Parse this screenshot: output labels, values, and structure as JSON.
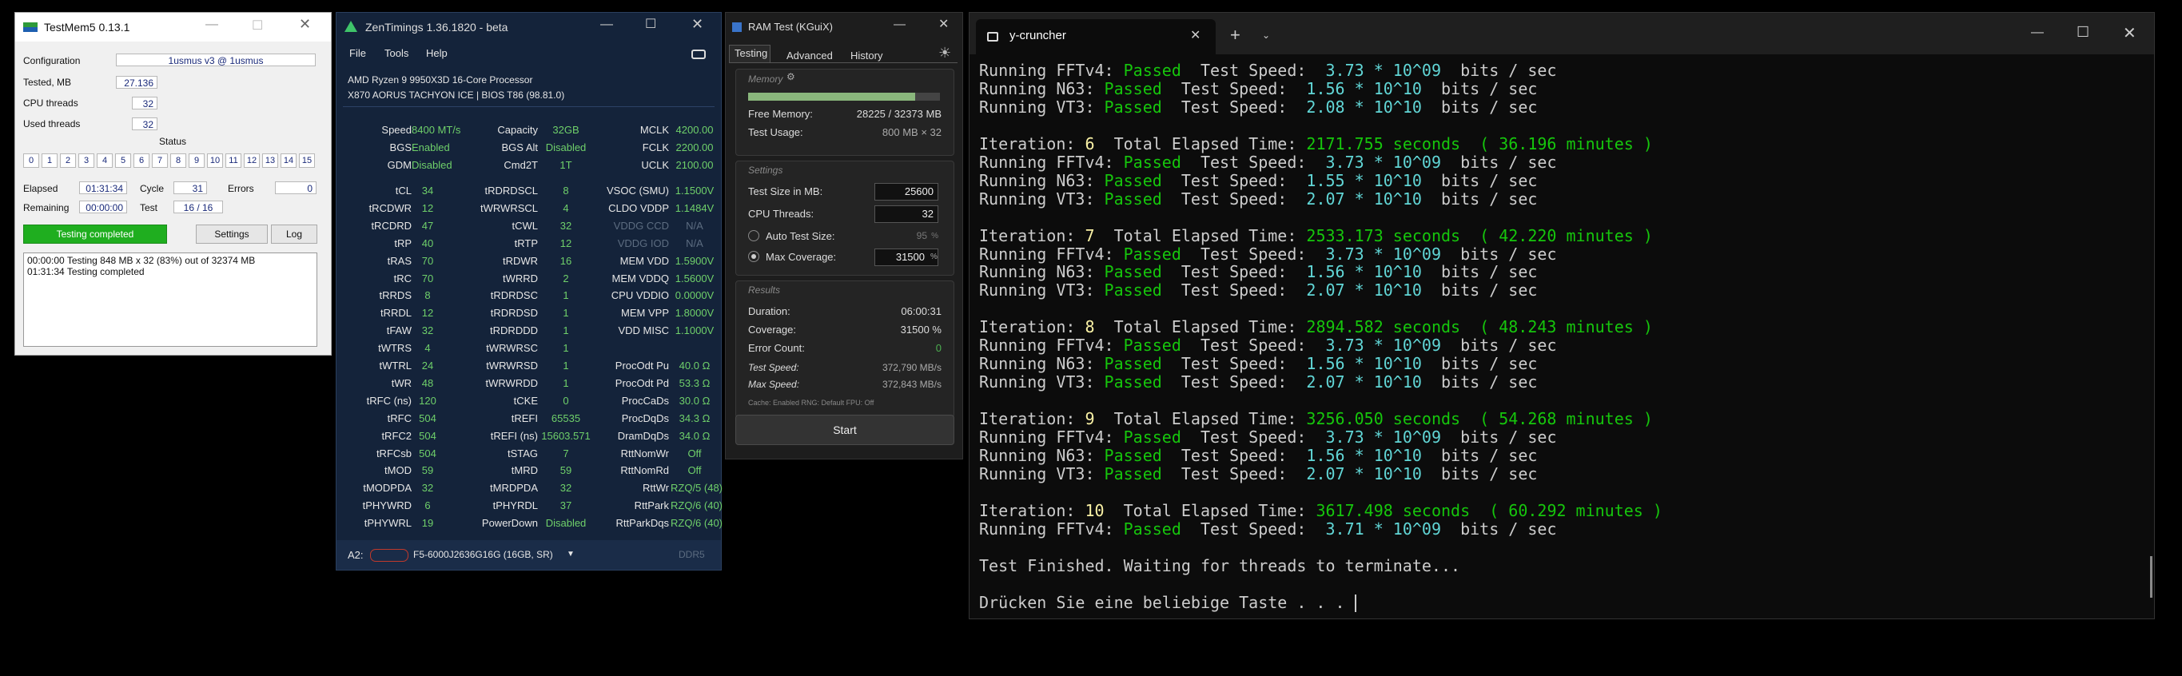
{
  "testmem5": {
    "title": "TestMem5  0.13.1",
    "labels": {
      "configuration": "Configuration",
      "tested": "Tested, MB",
      "cpu_threads": "CPU threads",
      "used_threads": "Used threads",
      "status": "Status",
      "elapsed": "Elapsed",
      "cycle": "Cycle",
      "errors": "Errors",
      "remaining": "Remaining",
      "test": "Test"
    },
    "values": {
      "configuration": "1usmus v3 @ 1usmus",
      "tested": "27.136",
      "cpu_threads": "32",
      "used_threads": "32",
      "elapsed": "01:31:34",
      "cycle": "31",
      "errors": "0",
      "remaining": "00:00:00",
      "test": "16 / 16"
    },
    "cells": [
      "0",
      "1",
      "2",
      "3",
      "4",
      "5",
      "6",
      "7",
      "8",
      "9",
      "10",
      "11",
      "12",
      "13",
      "14",
      "15"
    ],
    "buttons": {
      "status": "Testing completed",
      "settings": "Settings",
      "log": "Log"
    },
    "status_color": "#1fae1f",
    "log": [
      "00:00:00  Testing 848 MB x 32 (83%) out of 32374 MB",
      "01:31:34  Testing completed"
    ]
  },
  "zentimings": {
    "title": "ZenTimings 1.36.1820 - beta",
    "menu": [
      "File",
      "Tools",
      "Help"
    ],
    "cpu": "AMD Ryzen 9 9950X3D 16-Core Processor",
    "board": "X870 AORUS TACHYON ICE | BIOS T86 (98.81.0)",
    "top": [
      [
        "Speed",
        "8400 MT/s",
        "Capacity",
        "32GB",
        "MCLK",
        "4200.00"
      ],
      [
        "BGS",
        "Enabled",
        "BGS Alt",
        "Disabled",
        "FCLK",
        "2200.00"
      ],
      [
        "GDM",
        "Disabled",
        "Cmd2T",
        "1T",
        "UCLK",
        "2100.00"
      ]
    ],
    "timings": [
      [
        "tCL",
        "34",
        "tRDRDSCL",
        "8",
        "VSOC (SMU)",
        "1.1500V"
      ],
      [
        "tRCDWR",
        "12",
        "tWRWRSCL",
        "4",
        "CLDO VDDP",
        "1.1484V"
      ],
      [
        "tRCDRD",
        "47",
        "tCWL",
        "32",
        "VDDG CCD",
        "N/A"
      ],
      [
        "tRP",
        "40",
        "tRTP",
        "12",
        "VDDG IOD",
        "N/A"
      ],
      [
        "tRAS",
        "70",
        "tRDWR",
        "16",
        "MEM VDD",
        "1.5900V"
      ],
      [
        "tRC",
        "70",
        "tWRRD",
        "2",
        "MEM VDDQ",
        "1.5600V"
      ],
      [
        "tRRDS",
        "8",
        "tRDRDSC",
        "1",
        "CPU VDDIO",
        "0.0000V"
      ],
      [
        "tRRDL",
        "12",
        "tRDRDSD",
        "1",
        "MEM VPP",
        "1.8000V"
      ],
      [
        "tFAW",
        "32",
        "tRDRDDD",
        "1",
        "VDD MISC",
        "1.1000V"
      ],
      [
        "tWTRS",
        "4",
        "tWRWRSC",
        "1",
        "",
        ""
      ],
      [
        "tWTRL",
        "24",
        "tWRWRSD",
        "1",
        "ProcOdt Pu",
        "40.0 Ω"
      ],
      [
        "tWR",
        "48",
        "tWRWRDD",
        "1",
        "ProcOdt Pd",
        "53.3 Ω"
      ],
      [
        "tRFC (ns)",
        "120",
        "tCKE",
        "0",
        "ProcCaDs",
        "30.0 Ω"
      ],
      [
        "tRFC",
        "504",
        "tREFI",
        "65535",
        "ProcDqDs",
        "34.3 Ω"
      ],
      [
        "tRFC2",
        "504",
        "tREFI (ns)",
        "15603.571",
        "DramDqDs",
        "34.0 Ω"
      ],
      [
        "tRFCsb",
        "504",
        "tSTAG",
        "7",
        "RttNomWr",
        "Off"
      ],
      [
        "tMOD",
        "59",
        "tMRD",
        "59",
        "RttNomRd",
        "Off"
      ],
      [
        "tMODPDA",
        "32",
        "tMRDPDA",
        "32",
        "RttWr",
        "RZQ/5 (48)"
      ],
      [
        "tPHYWRD",
        "6",
        "tPHYRDL",
        "37",
        "RttPark",
        "RZQ/6 (40)"
      ],
      [
        "tPHYWRL",
        "19",
        "PowerDown",
        "Disabled",
        "RttParkDqs",
        "RZQ/6 (40)"
      ]
    ],
    "module_slot": "A2:",
    "module": "F5-6000J2636G16G (16GB, SR)",
    "ddr": "DDR5"
  },
  "ramtest": {
    "title": "RAM Test (KGuiX)",
    "tabs": [
      "Testing",
      "Advanced",
      "History"
    ],
    "memory": {
      "section": "Memory",
      "free_label": "Free Memory:",
      "free_value": "28225 / 32373 MB",
      "usage_label": "Test Usage:",
      "usage_value": "800 MB × 32",
      "fill_fraction": 0.87
    },
    "settings": {
      "section": "Settings",
      "size_label": "Test Size in MB:",
      "size_value": "25600",
      "threads_label": "CPU Threads:",
      "threads_value": "32",
      "auto_label": "Auto Test Size:",
      "auto_value": "95",
      "max_label": "Max Coverage:",
      "max_value": "31500",
      "pct": "%"
    },
    "results": {
      "section": "Results",
      "duration_label": "Duration:",
      "duration_value": "06:00:31",
      "coverage_label": "Coverage:",
      "coverage_value": "31500 %",
      "errors_label": "Error Count:",
      "errors_value": "0",
      "speed_label": "Test Speed:",
      "speed_value": "372,790 MB/s",
      "max_label": "Max Speed:",
      "max_value": "372,843 MB/s",
      "footer": "Cache: Enabled   RNG: Default   FPU: Off"
    },
    "start": "Start"
  },
  "terminal": {
    "tab_title": "y-cruncher",
    "lines": [
      [
        [
          "Running FFTv4: ",
          ""
        ],
        [
          "Passed",
          "g"
        ],
        [
          "  Test Speed:  ",
          ""
        ],
        [
          "3.73 * 10^09",
          "c"
        ],
        [
          "  bits / sec",
          ""
        ]
      ],
      [
        [
          "Running N63: ",
          ""
        ],
        [
          "Passed",
          "g"
        ],
        [
          "  Test Speed:  ",
          ""
        ],
        [
          "1.56 * 10^10",
          "c"
        ],
        [
          "  bits / sec",
          ""
        ]
      ],
      [
        [
          "Running VT3: ",
          ""
        ],
        [
          "Passed",
          "g"
        ],
        [
          "  Test Speed:  ",
          ""
        ],
        [
          "2.08 * 10^10",
          "c"
        ],
        [
          "  bits / sec",
          ""
        ]
      ],
      [],
      [
        [
          "Iteration: ",
          ""
        ],
        [
          "6",
          "y"
        ],
        [
          "  Total Elapsed Time: ",
          ""
        ],
        [
          "2171.755 seconds  ( 36.196 minutes )",
          "g"
        ]
      ],
      [
        [
          "Running FFTv4: ",
          ""
        ],
        [
          "Passed",
          "g"
        ],
        [
          "  Test Speed:  ",
          ""
        ],
        [
          "3.73 * 10^09",
          "c"
        ],
        [
          "  bits / sec",
          ""
        ]
      ],
      [
        [
          "Running N63: ",
          ""
        ],
        [
          "Passed",
          "g"
        ],
        [
          "  Test Speed:  ",
          ""
        ],
        [
          "1.55 * 10^10",
          "c"
        ],
        [
          "  bits / sec",
          ""
        ]
      ],
      [
        [
          "Running VT3: ",
          ""
        ],
        [
          "Passed",
          "g"
        ],
        [
          "  Test Speed:  ",
          ""
        ],
        [
          "2.07 * 10^10",
          "c"
        ],
        [
          "  bits / sec",
          ""
        ]
      ],
      [],
      [
        [
          "Iteration: ",
          ""
        ],
        [
          "7",
          "y"
        ],
        [
          "  Total Elapsed Time: ",
          ""
        ],
        [
          "2533.173 seconds  ( 42.220 minutes )",
          "g"
        ]
      ],
      [
        [
          "Running FFTv4: ",
          ""
        ],
        [
          "Passed",
          "g"
        ],
        [
          "  Test Speed:  ",
          ""
        ],
        [
          "3.73 * 10^09",
          "c"
        ],
        [
          "  bits / sec",
          ""
        ]
      ],
      [
        [
          "Running N63: ",
          ""
        ],
        [
          "Passed",
          "g"
        ],
        [
          "  Test Speed:  ",
          ""
        ],
        [
          "1.56 * 10^10",
          "c"
        ],
        [
          "  bits / sec",
          ""
        ]
      ],
      [
        [
          "Running VT3: ",
          ""
        ],
        [
          "Passed",
          "g"
        ],
        [
          "  Test Speed:  ",
          ""
        ],
        [
          "2.07 * 10^10",
          "c"
        ],
        [
          "  bits / sec",
          ""
        ]
      ],
      [],
      [
        [
          "Iteration: ",
          ""
        ],
        [
          "8",
          "y"
        ],
        [
          "  Total Elapsed Time: ",
          ""
        ],
        [
          "2894.582 seconds  ( 48.243 minutes )",
          "g"
        ]
      ],
      [
        [
          "Running FFTv4: ",
          ""
        ],
        [
          "Passed",
          "g"
        ],
        [
          "  Test Speed:  ",
          ""
        ],
        [
          "3.73 * 10^09",
          "c"
        ],
        [
          "  bits / sec",
          ""
        ]
      ],
      [
        [
          "Running N63: ",
          ""
        ],
        [
          "Passed",
          "g"
        ],
        [
          "  Test Speed:  ",
          ""
        ],
        [
          "1.56 * 10^10",
          "c"
        ],
        [
          "  bits / sec",
          ""
        ]
      ],
      [
        [
          "Running VT3: ",
          ""
        ],
        [
          "Passed",
          "g"
        ],
        [
          "  Test Speed:  ",
          ""
        ],
        [
          "2.07 * 10^10",
          "c"
        ],
        [
          "  bits / sec",
          ""
        ]
      ],
      [],
      [
        [
          "Iteration: ",
          ""
        ],
        [
          "9",
          "y"
        ],
        [
          "  Total Elapsed Time: ",
          ""
        ],
        [
          "3256.050 seconds  ( 54.268 minutes )",
          "g"
        ]
      ],
      [
        [
          "Running FFTv4: ",
          ""
        ],
        [
          "Passed",
          "g"
        ],
        [
          "  Test Speed:  ",
          ""
        ],
        [
          "3.73 * 10^09",
          "c"
        ],
        [
          "  bits / sec",
          ""
        ]
      ],
      [
        [
          "Running N63: ",
          ""
        ],
        [
          "Passed",
          "g"
        ],
        [
          "  Test Speed:  ",
          ""
        ],
        [
          "1.56 * 10^10",
          "c"
        ],
        [
          "  bits / sec",
          ""
        ]
      ],
      [
        [
          "Running VT3: ",
          ""
        ],
        [
          "Passed",
          "g"
        ],
        [
          "  Test Speed:  ",
          ""
        ],
        [
          "2.07 * 10^10",
          "c"
        ],
        [
          "  bits / sec",
          ""
        ]
      ],
      [],
      [
        [
          "Iteration: ",
          ""
        ],
        [
          "10",
          "y"
        ],
        [
          "  Total Elapsed Time: ",
          ""
        ],
        [
          "3617.498 seconds  ( 60.292 minutes )",
          "g"
        ]
      ],
      [
        [
          "Running FFTv4: ",
          ""
        ],
        [
          "Passed",
          "g"
        ],
        [
          "  Test Speed:  ",
          ""
        ],
        [
          "3.71 * 10^09",
          "c"
        ],
        [
          "  bits / sec",
          ""
        ]
      ],
      [],
      [
        [
          "Test Finished. Waiting for threads to terminate...",
          ""
        ]
      ],
      [],
      [
        [
          "Drücken Sie eine beliebige Taste . . . ",
          ""
        ]
      ]
    ]
  }
}
